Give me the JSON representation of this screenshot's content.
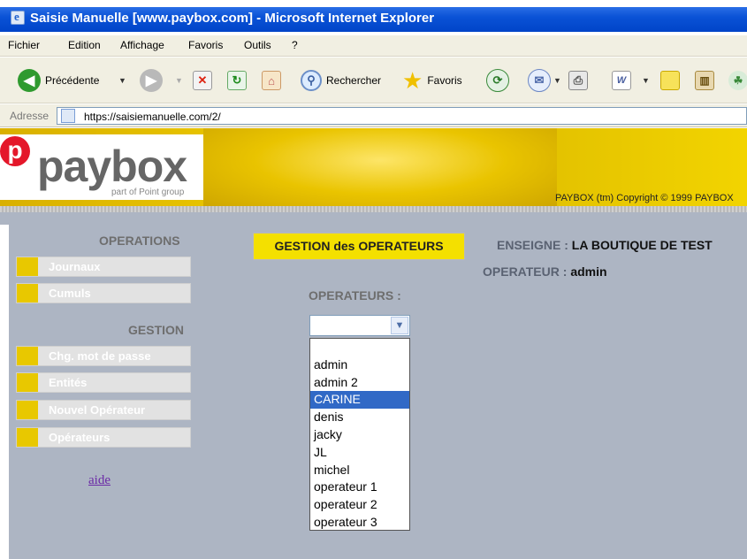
{
  "window": {
    "title": "Saisie Manuelle [www.paybox.com] - Microsoft Internet Explorer"
  },
  "menu": [
    "Fichier",
    "Edition",
    "Affichage",
    "Favoris",
    "Outils",
    "?"
  ],
  "toolbar": {
    "back_label": "Précédente",
    "search_label": "Rechercher",
    "favorites_label": "Favoris"
  },
  "address": {
    "label": "Adresse",
    "url": "https://saisiemanuelle.com/2/"
  },
  "banner": {
    "logo_word": "paybox",
    "logo_sub": "part of Point group",
    "copyright": "PAYBOX (tm) Copyright © 1999 PAYBOX",
    "accent": "#e8c800"
  },
  "sidebar": {
    "operations_heading": "OPERATIONS",
    "operations": [
      "Journaux",
      "Cumuls"
    ],
    "gestion_heading": "GESTION",
    "gestion": [
      "Chg. mot de passe",
      "Entités",
      "Nouvel Opérateur",
      "Opérateurs"
    ],
    "help_link": "aide"
  },
  "main": {
    "section_title": "GESTION des OPERATEURS",
    "enseigne_label": "ENSEIGNE :",
    "enseigne_value": "LA BOUTIQUE DE TEST",
    "operateur_label": "OPERATEUR :",
    "operateur_value": "admin",
    "operators_label": "OPERATEURS :",
    "selected_value": "",
    "options": [
      "",
      "admin",
      "admin 2",
      "CARINE",
      "denis",
      "jacky",
      "JL",
      "michel",
      "operateur 1",
      "operateur 2",
      "operateur 3"
    ],
    "highlighted_option": "CARINE"
  }
}
